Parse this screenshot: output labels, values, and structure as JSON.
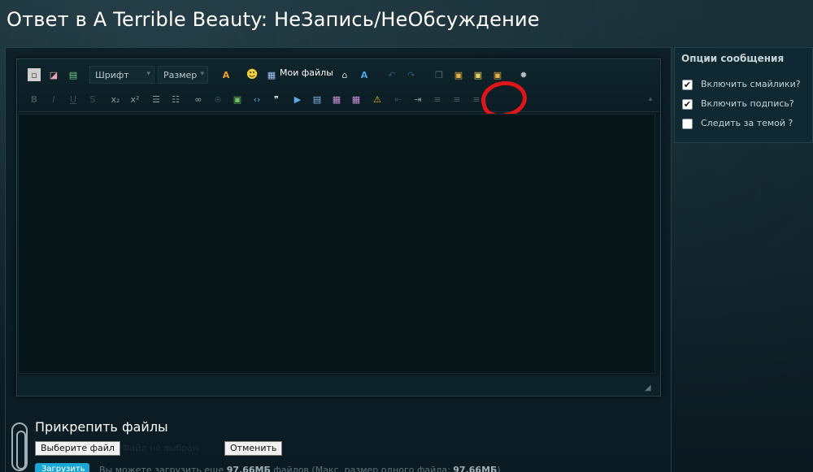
{
  "page": {
    "title": "Ответ в A Terrible Beauty: НеЗапись/НеОбсуждение"
  },
  "toolbar": {
    "font_select": "Шрифт",
    "size_select": "Размер",
    "my_files": "Мои файлы",
    "row1_icons": [
      "source-icon",
      "eraser-icon",
      "image-icon",
      "font-color-icon",
      "smiley-icon",
      "files-icon",
      "home-icon",
      "spellcheck-icon",
      "undo-icon",
      "redo-icon",
      "copy-icon",
      "paste-icon",
      "paste-text-icon",
      "paste-word-icon",
      "settings-icon"
    ],
    "row2_icons": [
      "bold-icon",
      "italic-icon",
      "underline-icon",
      "strike-icon",
      "subscript-icon",
      "superscript-icon",
      "bullet-list-icon",
      "number-list-icon",
      "link-icon",
      "unlink-icon",
      "picture-icon",
      "code-icon",
      "quote-icon",
      "media-icon",
      "table-icon",
      "table2-icon",
      "table3-icon",
      "warning-icon",
      "outdent-icon",
      "indent-icon",
      "align-left-icon",
      "align-center-icon",
      "align-right-icon"
    ]
  },
  "sidebar": {
    "title": "Опции сообщения",
    "options": [
      {
        "label": "Включить смайлики?",
        "checked": true
      },
      {
        "label": "Включить подпись?",
        "checked": true
      },
      {
        "label": "Следить за темой ?",
        "checked": false
      }
    ]
  },
  "attachments": {
    "title": "Прикрепить файлы",
    "choose_button": "Выберите файл",
    "no_file": "Файл не выбран",
    "cancel_button": "Отменить",
    "upload_button": "Загрузить",
    "upload_info_prefix": "Вы можете загрузить еще",
    "upload_remaining": "97.66МБ",
    "upload_info_middle": "файлов (Макс. размер одного файла:",
    "upload_max": "97.66МБ",
    "upload_info_suffix": ")"
  },
  "colors": {
    "accent": "#19a7d6",
    "annotation": "#e0151a"
  }
}
